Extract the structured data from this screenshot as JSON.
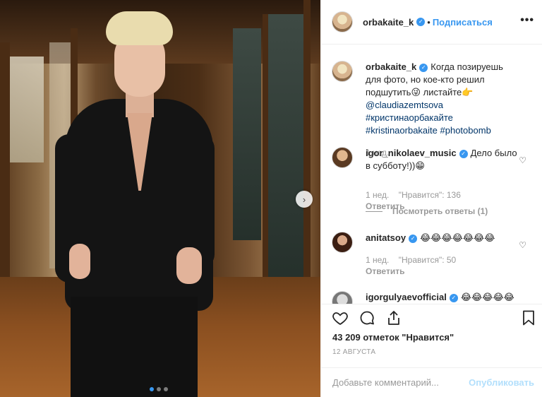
{
  "post": {
    "username": "orbakaite_k",
    "verified_icon": "verified-badge-icon",
    "follow_separator": "•",
    "follow_label": "Подписаться",
    "more_label": "•••",
    "caption_text": "Когда позируешь для фото, но кое-кто решил подшутить😜 листайте👉",
    "caption_mention": "@claudiazemtsova",
    "caption_tags": [
      "#кристинаорбакайте",
      "#kristinaorbakaite",
      "#photobomb"
    ],
    "caption_time": "1 нед.",
    "carousel": {
      "next_label": "›",
      "slides": 3,
      "active_slide": 1
    }
  },
  "comments": [
    {
      "username": "igor_nikolaev_music",
      "text": "Дело было в субботу!))😁",
      "time": "1 нед.",
      "likes": "\"Нравится\": 136",
      "reply_label": "Ответить",
      "view_replies": "Посмотреть ответы (1)"
    },
    {
      "username": "anitatsoy",
      "text": "😂😂😂😂😂😂😂",
      "time": "1 нед.",
      "likes": "\"Нравится\": 50",
      "reply_label": "Ответить"
    },
    {
      "username": "igorgulyaevofficial",
      "text": "😂😂😂😂😂"
    }
  ],
  "actions": {
    "like_icon": "heart-icon",
    "comment_icon": "comment-icon",
    "share_icon": "share-icon",
    "save_icon": "bookmark-icon"
  },
  "likes_total": "43 209 отметок \"Нравится\"",
  "date": "12 августа",
  "add_comment": {
    "placeholder": "Добавьте комментарий...",
    "publish_label": "Опубликовать"
  },
  "colors": {
    "accent": "#3897f0",
    "publish_disabled": "#b2dffc",
    "muted": "#999999",
    "link": "#003569"
  }
}
